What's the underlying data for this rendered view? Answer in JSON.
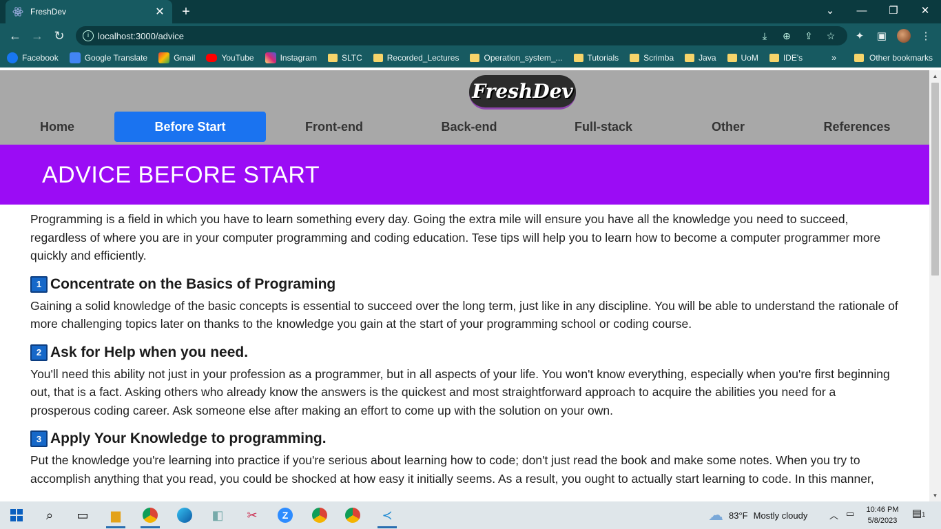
{
  "browser": {
    "tab_title": "FreshDev",
    "url": "localhost:3000/advice",
    "bookmarks": [
      {
        "label": "Facebook",
        "color": "#1877f2"
      },
      {
        "label": "Google Translate",
        "color": "#4285f4"
      },
      {
        "label": "Gmail",
        "color": "#ea4335"
      },
      {
        "label": "YouTube",
        "color": "#ff0000"
      },
      {
        "label": "Instagram",
        "color": "#e1306c"
      },
      {
        "label": "SLTC",
        "folder": true
      },
      {
        "label": "Recorded_Lectures",
        "folder": true
      },
      {
        "label": "Operation_system_...",
        "folder": true
      },
      {
        "label": "Tutorials",
        "folder": true
      },
      {
        "label": "Scrimba",
        "folder": true
      },
      {
        "label": "Java",
        "folder": true
      },
      {
        "label": "UoM",
        "folder": true
      },
      {
        "label": "IDE's",
        "folder": true
      }
    ],
    "other_bookmarks": "Other bookmarks"
  },
  "site": {
    "logo": "FreshDev",
    "nav": [
      "Home",
      "Before Start",
      "Front-end",
      "Back-end",
      "Full-stack",
      "Other",
      "References"
    ],
    "active_nav": "Before Start",
    "banner_title": "ADVICE BEFORE START",
    "intro": "Programming is a field in which you have to learn something every day. Going the extra mile will ensure you have all the knowledge you need to succeed, regardless of where you are in your computer programming and coding education. Tese tips will help you to learn how to become a computer programmer more quickly and efficiently.",
    "tips": [
      {
        "number": "1",
        "title": "Concentrate on the Basics of Programing",
        "body": "Gaining a solid knowledge of the basic concepts is essential to succeed over the long term, just like in any discipline. You will be able to understand the rationale of more challenging topics later on thanks to the knowledge you gain at the start of your programming school or coding course."
      },
      {
        "number": "2",
        "title": "Ask for Help when you need.",
        "body": "You'll need this ability not just in your profession as a programmer, but in all aspects of your life. You won't know everything, especially when you're first beginning out, that is a fact. Asking others who already know the answers is the quickest and most straightforward approach to acquire the abilities you need for a prosperous coding career. Ask someone else after making an effort to come up with the solution on your own."
      },
      {
        "number": "3",
        "title": "Apply Your Knowledge to programming.",
        "body": "Put the knowledge you're learning into practice if you're serious about learning how to code; don't just read the book and make some notes. When you try to accomplish anything that you read, you could be shocked at how easy it initially seems. As a result, you ought to actually start learning to code. In this manner,"
      }
    ]
  },
  "taskbar": {
    "weather_temp": "83°F",
    "weather_text": "Mostly cloudy",
    "time": "10:46 PM",
    "date": "5/8/2023",
    "notification_count": "1"
  }
}
